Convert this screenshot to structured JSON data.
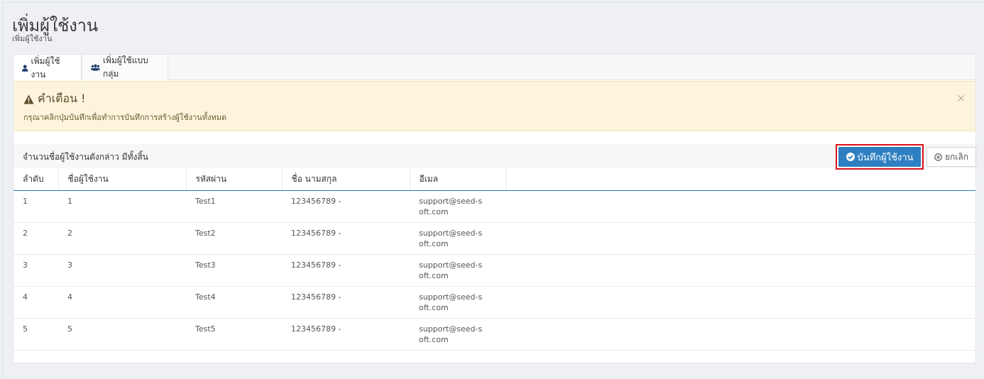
{
  "header": {
    "title": "เพิ่มผู้ใช้งาน",
    "subtitle": "เพิ่มผู้ใช้งาน"
  },
  "tabs": [
    {
      "label": "เพิ่มผู้ใช้งาน",
      "icon": "user-icon",
      "active": true
    },
    {
      "label": "เพิ่มผู้ใช้แบบกลุ่ม",
      "icon": "users-icon",
      "active": false
    }
  ],
  "alert": {
    "title": "คำเตือน !",
    "message": "กรุณาคลิกปุ่มบันทึกเพื่อทำการบันทึกการสร้างผู้ใช้งานทั้งหมด",
    "close": "×"
  },
  "summary": {
    "count_text": "จำนวนชื่อผู้ใช้งานดังกล่าว มีทั้งสิ้น"
  },
  "actions": {
    "save_label": "บันทึกผู้ใช้งาน",
    "cancel_label": "ยกเลิก"
  },
  "table": {
    "columns": [
      "ลำดับ",
      "ชื่อผู้ใช้งาน",
      "รหัสผ่าน",
      "ชื่อ นามสกุล",
      "อีเมล"
    ],
    "rows": [
      {
        "no": "1",
        "username": "1",
        "password": "Test1",
        "fullname": "123456789 -",
        "email": "support@seed-soft.com"
      },
      {
        "no": "2",
        "username": "2",
        "password": "Test2",
        "fullname": "123456789 -",
        "email": "support@seed-soft.com"
      },
      {
        "no": "3",
        "username": "3",
        "password": "Test3",
        "fullname": "123456789 -",
        "email": "support@seed-soft.com"
      },
      {
        "no": "4",
        "username": "4",
        "password": "Test4",
        "fullname": "123456789 -",
        "email": "support@seed-soft.com"
      },
      {
        "no": "5",
        "username": "5",
        "password": "Test5",
        "fullname": "123456789 -",
        "email": "support@seed-soft.com"
      }
    ]
  },
  "colors": {
    "primary": "#2d7fc1",
    "highlight_border": "#d8101a",
    "alert_bg": "#fcf4dc"
  }
}
